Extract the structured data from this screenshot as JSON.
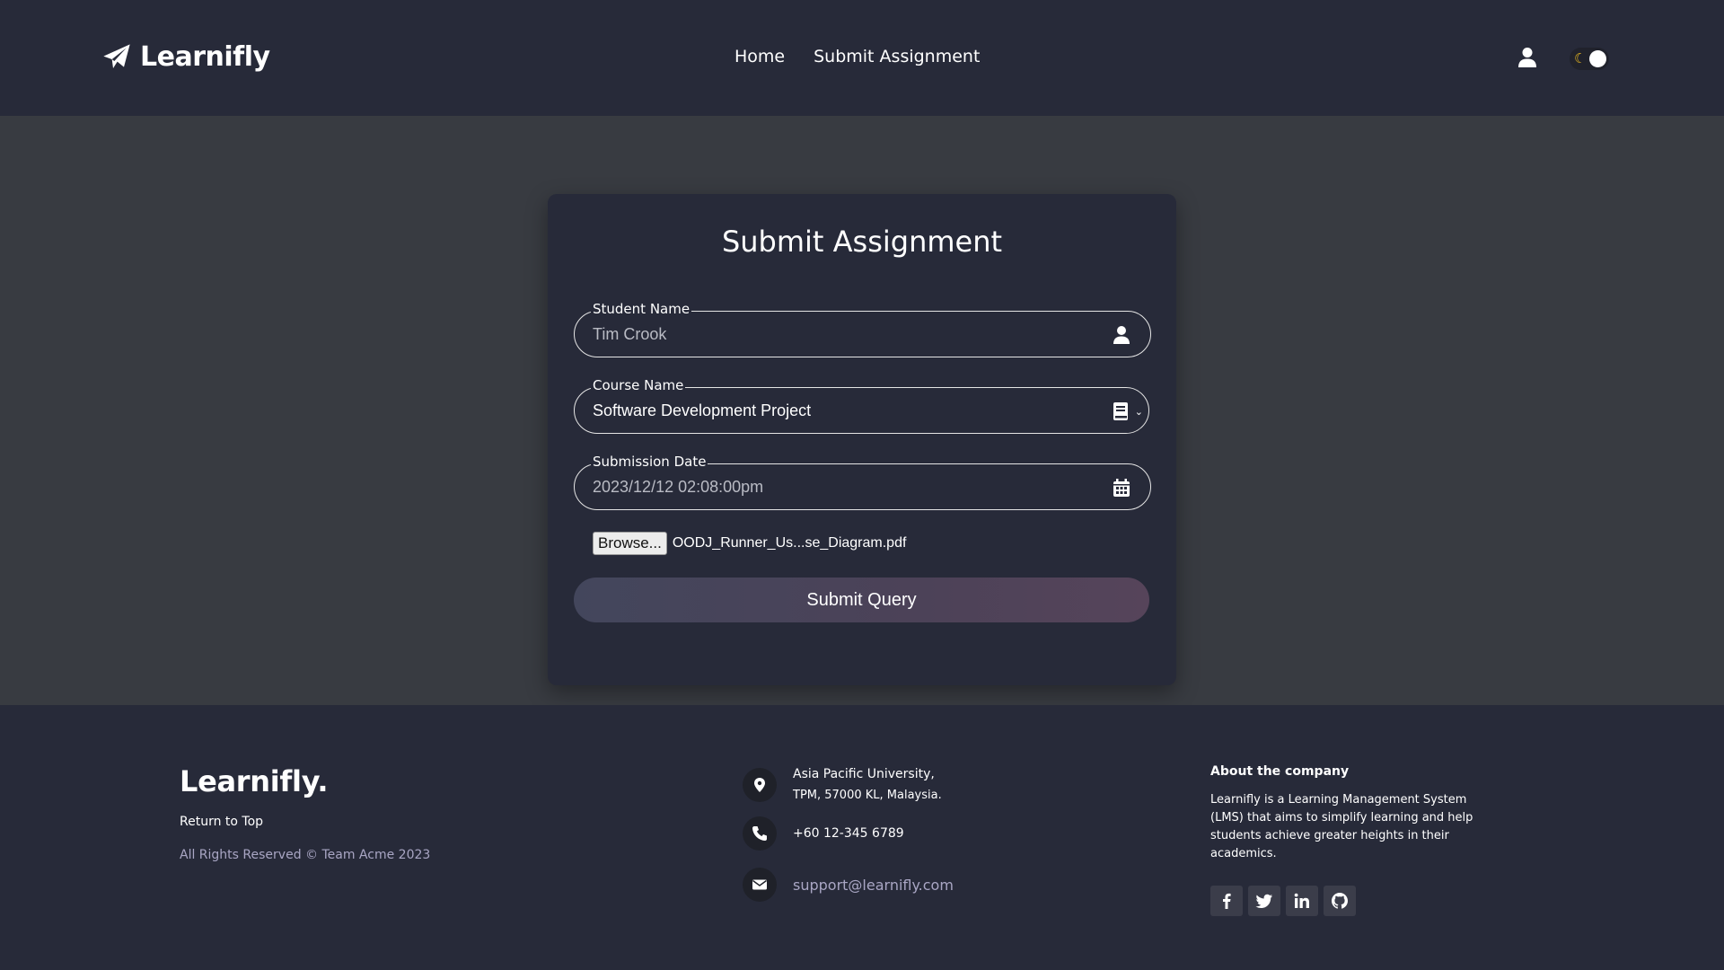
{
  "header": {
    "logo": "Learnifly",
    "nav": [
      "Home",
      "Submit Assignment"
    ]
  },
  "form": {
    "title": "Submit Assignment",
    "student": {
      "label": "Student Name",
      "value": "Tim Crook"
    },
    "course": {
      "label": "Course Name",
      "value": "Software Development Project"
    },
    "date": {
      "label": "Submission Date",
      "value": "2023/12/12 02:08:00pm"
    },
    "file": {
      "button": "Browse...",
      "name": "OODJ_Runner_Us...se_Diagram.pdf"
    },
    "submit": "Submit Query"
  },
  "footer": {
    "brand": "Learnifly.",
    "return_top": "Return to Top",
    "rights": "All Rights Reserved © Team Acme 2023",
    "address_line1": "Asia Pacific University,",
    "address_line2": "TPM, 57000 KL, Malaysia.",
    "phone": "+60 12-345 6789",
    "email": "support@learnifly.com",
    "about_title": "About the company",
    "about_text": "Learnifly is a Learning Management System (LMS) that aims to simplify learning and help students achieve greater heights in their academics.",
    "socials": [
      "facebook-icon",
      "twitter-icon",
      "linkedin-icon",
      "github-icon"
    ]
  },
  "colors": {
    "header_bg": "#272a39",
    "page_bg": "#383b41",
    "accent_link": "#a9a6c4",
    "moon": "#e8b820"
  }
}
